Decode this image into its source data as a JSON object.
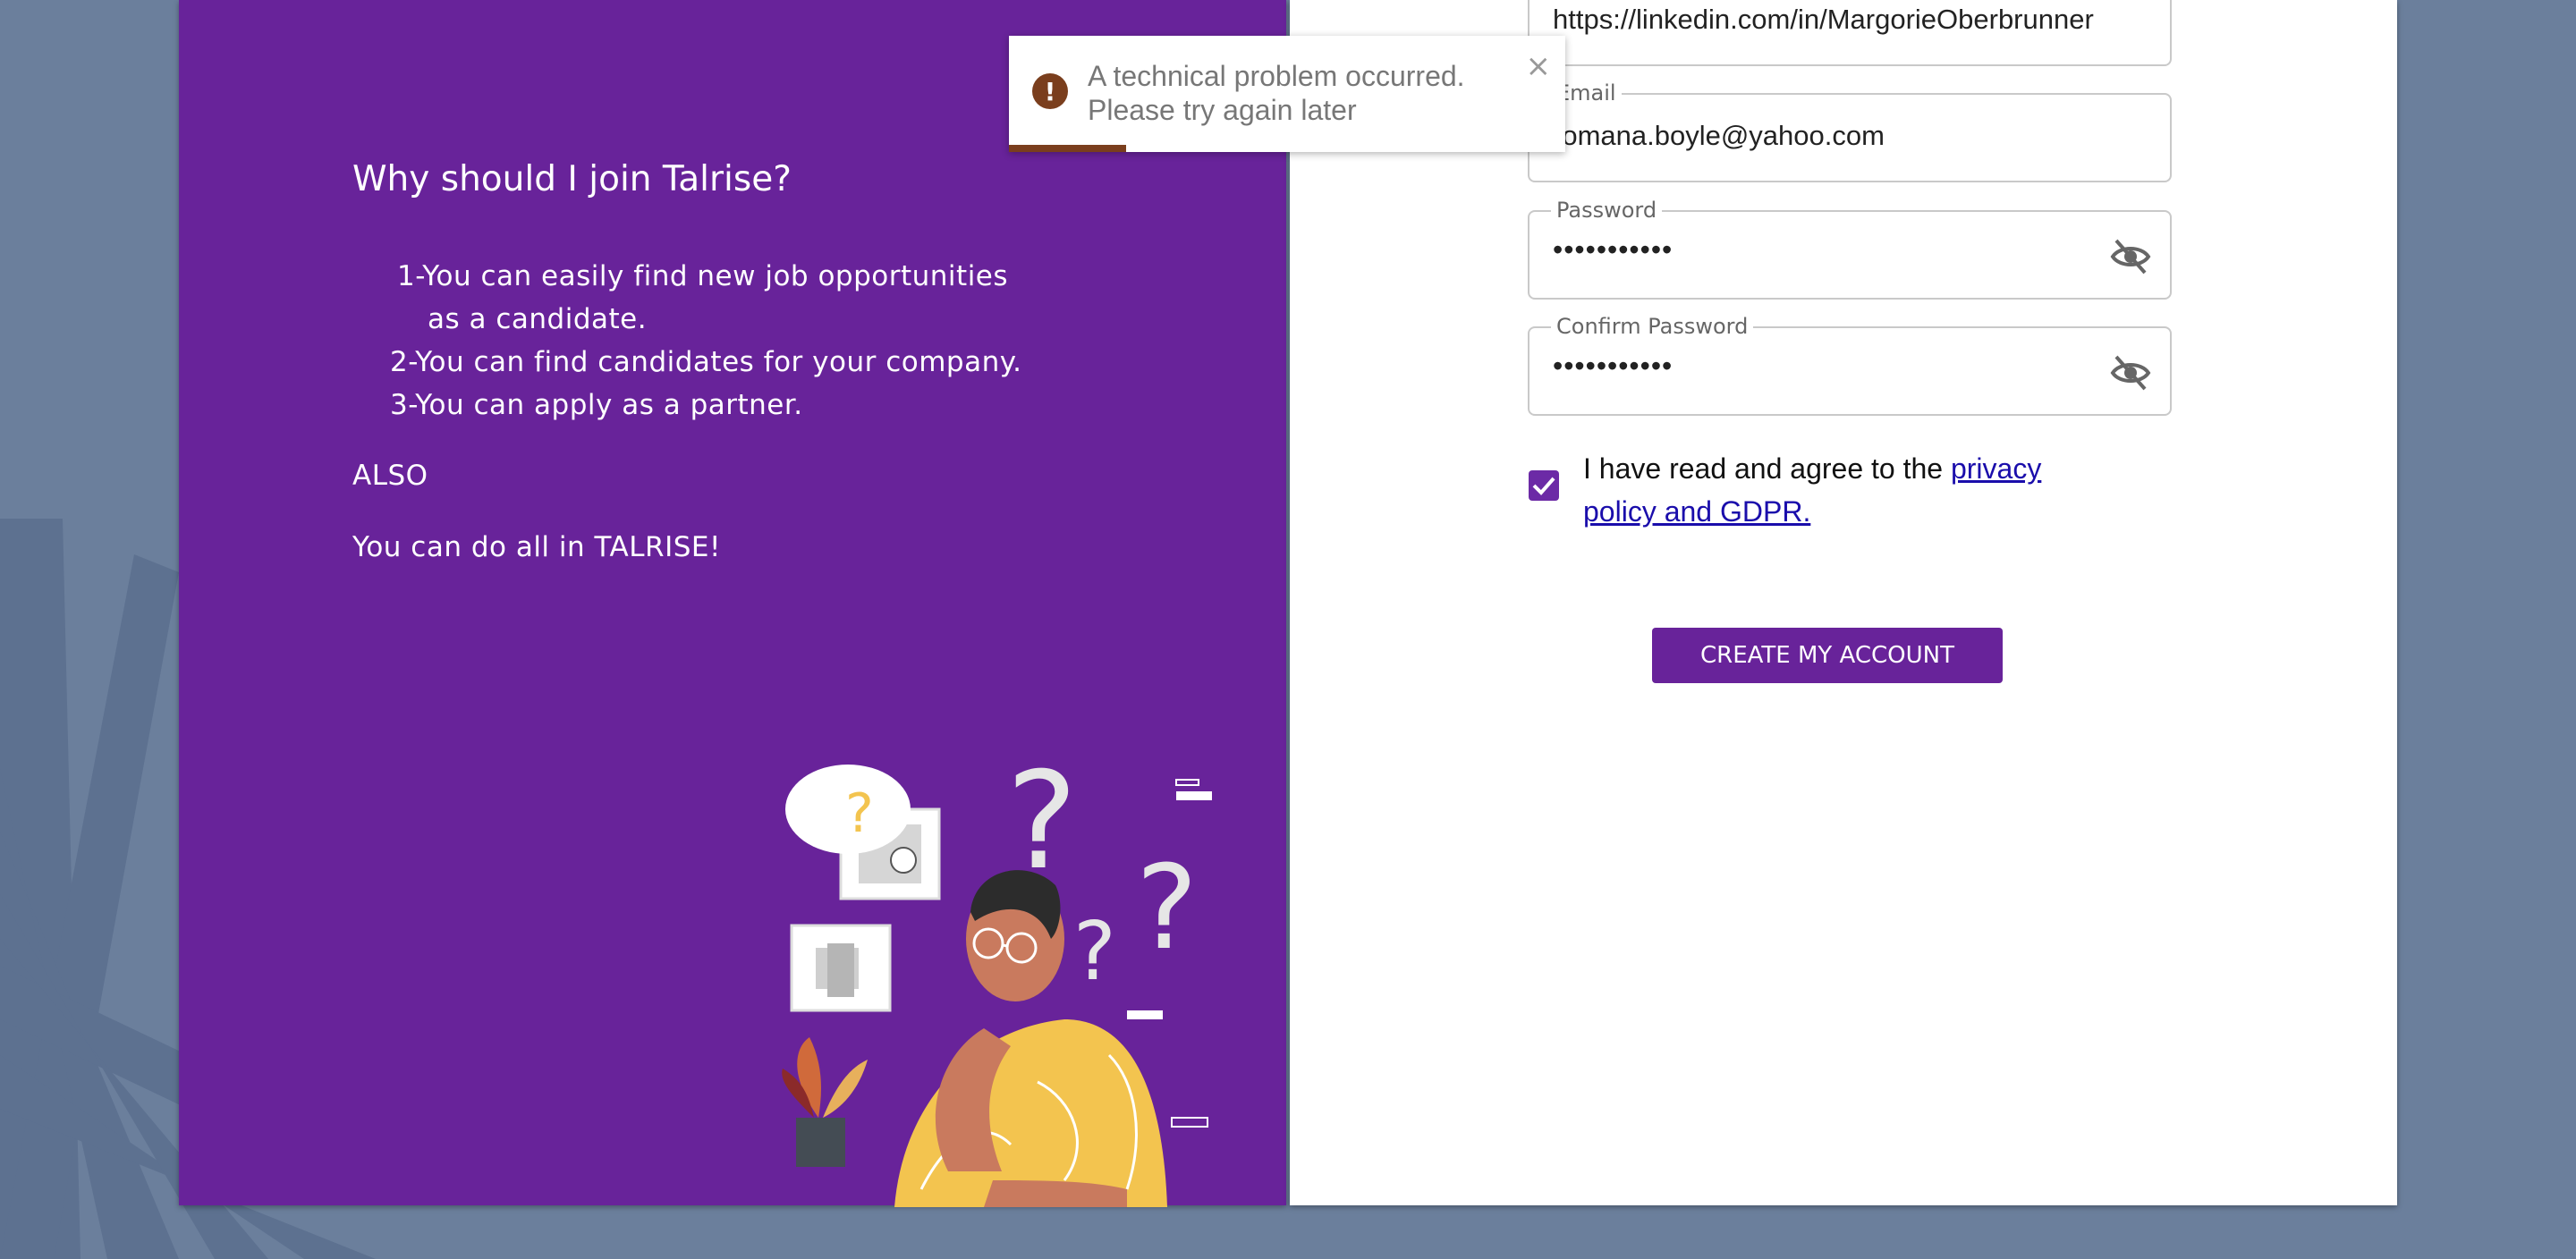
{
  "left_panel": {
    "title": "Why should I join Talrise?",
    "benefits": [
      {
        "text": "1-You can easily find new job opportunities",
        "wrap": "as a candidate."
      },
      {
        "text": "2-You can find candidates for your company."
      },
      {
        "text": "3-You can apply as a partner."
      }
    ],
    "also": "ALSO",
    "tagline": "You can do all in TALRISE!",
    "illustration_icon": "thinking-person-illustration",
    "question_mark": "?"
  },
  "form": {
    "linkedin": {
      "value": "https://linkedin.com/in/MargorieOberbrunner"
    },
    "email": {
      "label": "Email",
      "value": "romana.boyle@yahoo.com"
    },
    "password": {
      "label": "Password",
      "value": "•••••••••••",
      "icon": "eye-off-icon"
    },
    "confirm_password": {
      "label": "Confirm Password",
      "value": "•••••••••••",
      "icon": "eye-off-icon"
    },
    "agree": {
      "checked": true,
      "text": "I have read and agree to the ",
      "link": "privacy policy and GDPR."
    },
    "submit_label": "CREATE MY ACCOUNT"
  },
  "toast": {
    "message": "A technical problem occurred. Please try again later",
    "icon": "!",
    "close": "×",
    "progress": 0.21
  },
  "colors": {
    "brand_purple": "#68239a",
    "background": "#6b7f9c",
    "toast_accent": "#7a3e1d",
    "checkbox": "#6c2aa6"
  }
}
